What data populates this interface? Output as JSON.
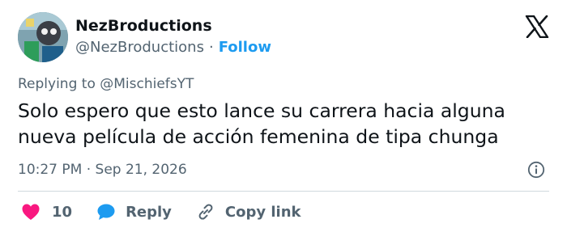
{
  "author": {
    "name": "NezBroductions",
    "handle": "@NezBroductions",
    "separator": "·",
    "follow_label": "Follow"
  },
  "header": {
    "logo_icon": "x-logo-icon"
  },
  "reply_context": {
    "prefix": "Replying to",
    "mention": "@MischiefsYT"
  },
  "tweet": {
    "lines": [
      "Solo espero que esto lance su carrera hacia alguna",
      "nueva película de acción femenina de tipa chunga"
    ]
  },
  "meta": {
    "timestamp": "10:27 PM · Sep 21, 2026",
    "info_icon": "info-icon"
  },
  "actions": {
    "like_count": "10",
    "reply_label": "Reply",
    "copy_link_label": "Copy link"
  },
  "colors": {
    "text": "#0f1419",
    "muted": "#536471",
    "link": "#1d9bf0",
    "heart": "#f91880",
    "divider": "#cfd9de"
  }
}
